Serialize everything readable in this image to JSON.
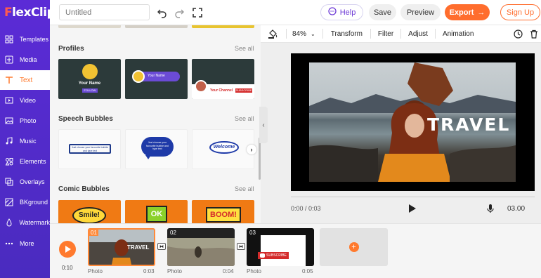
{
  "app": {
    "logo_prefix": "F",
    "logo_rest": "lexClip"
  },
  "sidebar": {
    "items": [
      {
        "label": "Templates",
        "icon": "templates-icon"
      },
      {
        "label": "Media",
        "icon": "media-icon"
      },
      {
        "label": "Text",
        "icon": "text-icon",
        "active": true
      },
      {
        "label": "Video",
        "icon": "video-icon"
      },
      {
        "label": "Photo",
        "icon": "photo-icon"
      },
      {
        "label": "Music",
        "icon": "music-icon"
      },
      {
        "label": "Elements",
        "icon": "elements-icon"
      },
      {
        "label": "Overlays",
        "icon": "overlays-icon"
      },
      {
        "label": "BKground",
        "icon": "background-icon"
      },
      {
        "label": "Watermark",
        "icon": "watermark-icon"
      },
      {
        "label": "More",
        "icon": "more-icon"
      }
    ]
  },
  "topbar": {
    "title_placeholder": "Untitled",
    "help": "Help",
    "save": "Save",
    "preview": "Preview",
    "export": "Export",
    "signup": "Sign Up"
  },
  "panel": {
    "sections": [
      {
        "title": "Profiles",
        "see_all": "See all"
      },
      {
        "title": "Speech Bubbles",
        "see_all": "See all"
      },
      {
        "title": "Comic Bubbles",
        "see_all": "See all"
      }
    ],
    "profiles": {
      "name": "Your Name",
      "follow": "FOLLOW",
      "channel": "Your Channel",
      "subscribe": "SUBSCRIBE"
    },
    "speech": {
      "text1": "Just choose your favourite bubble and type text",
      "text2": "Just choose your favourite bubble and type text",
      "welcome": "Welcome"
    },
    "comic": {
      "smile": "Smile!",
      "ok": "OK",
      "boom": "BOOM!"
    }
  },
  "toolbar": {
    "zoom": "84%",
    "transform": "Transform",
    "filter": "Filter",
    "adjust": "Adjust",
    "animation": "Animation"
  },
  "stage": {
    "overlay_text": "TRAVEL",
    "time_current": "0:00",
    "time_total": "0:03",
    "duration": "03.00"
  },
  "timeline": {
    "total": "0:10",
    "clips": [
      {
        "num": "01",
        "type": "Photo",
        "duration": "0:03"
      },
      {
        "num": "02",
        "type": "Photo",
        "duration": "0:04"
      },
      {
        "num": "03",
        "type": "Photo",
        "duration": "0:05"
      }
    ],
    "clip1_text": "TRAVEL",
    "clip3_text": "SUBSCRIBE"
  },
  "colors": {
    "brand": "#5b2bd6",
    "accent": "#ff6d2d"
  }
}
